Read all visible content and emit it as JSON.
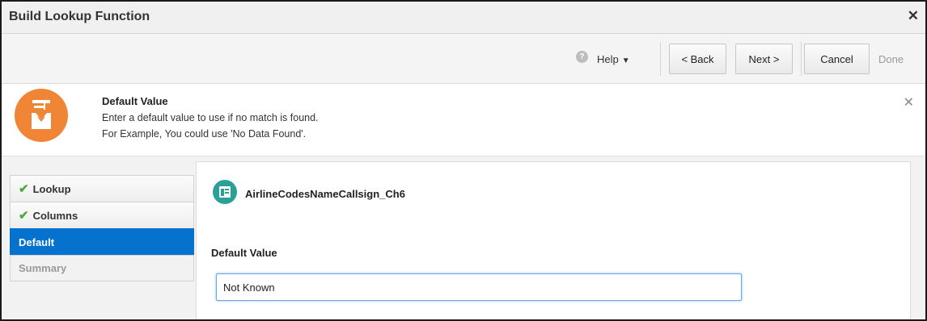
{
  "dialog": {
    "title": "Build Lookup Function",
    "close_symbol": "✕"
  },
  "toolbar": {
    "help_icon": "?",
    "help_label": "Help",
    "help_caret": "▼",
    "back_label": "< Back",
    "next_label": "Next >",
    "cancel_label": "Cancel",
    "done_label": "Done"
  },
  "info": {
    "title": "Default Value",
    "line1": "Enter a default value to use if no match is found.",
    "line2": "For Example, You could use 'No Data Found'.",
    "close_symbol": "✕",
    "icon": "graduate-icon",
    "icon_color": "#f08536"
  },
  "nav": {
    "check_symbol": "✔",
    "items": [
      {
        "label": "Lookup",
        "state": "complete"
      },
      {
        "label": "Columns",
        "state": "complete"
      },
      {
        "label": "Default",
        "state": "active"
      },
      {
        "label": "Summary",
        "state": "disabled"
      }
    ]
  },
  "main": {
    "dataset_name": "AirlineCodesNameCallsign_Ch6",
    "dataset_icon": "dataset-icon",
    "field_label": "Default Value",
    "field_value": "Not Known"
  },
  "colors": {
    "accent": "#0572ce",
    "check": "#53a93f",
    "dataset_icon": "#2aa198"
  }
}
